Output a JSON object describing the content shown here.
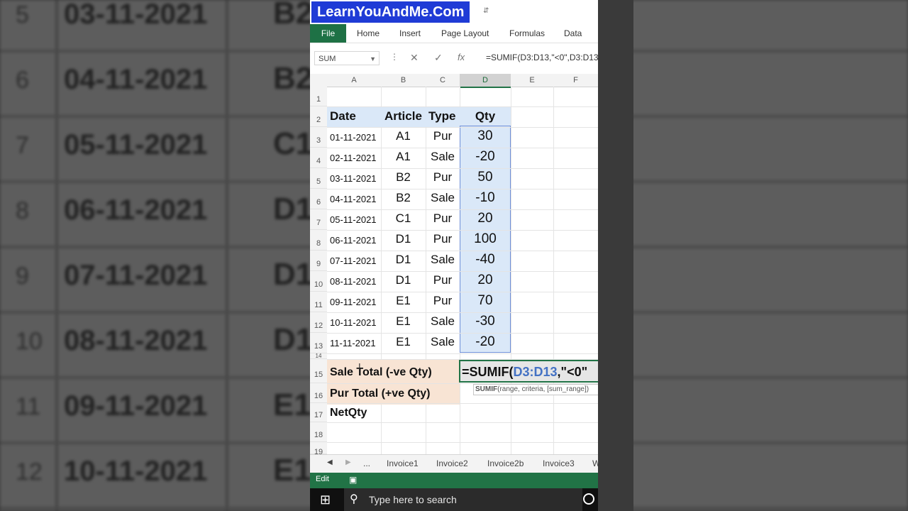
{
  "banner": {
    "title": "LearnYouAndMe.Com"
  },
  "ribbon": {
    "tabs": [
      "File",
      "Home",
      "Insert",
      "Page Layout",
      "Formulas",
      "Data"
    ]
  },
  "formula_bar": {
    "name_box": "SUM",
    "fx": "fx",
    "formula": "=SUMIF(D3:D13,\"<0\",D3:D13"
  },
  "columns": [
    "A",
    "B",
    "C",
    "D",
    "E",
    "F"
  ],
  "selected_column": "D",
  "headers": {
    "date": "Date",
    "article": "Article",
    "type": "Type",
    "qty": "Qty"
  },
  "rows": [
    {
      "row": "3",
      "date": "01-11-2021",
      "article": "A1",
      "type": "Pur",
      "qty": "30"
    },
    {
      "row": "4",
      "date": "02-11-2021",
      "article": "A1",
      "type": "Sale",
      "qty": "-20"
    },
    {
      "row": "5",
      "date": "03-11-2021",
      "article": "B2",
      "type": "Pur",
      "qty": "50"
    },
    {
      "row": "6",
      "date": "04-11-2021",
      "article": "B2",
      "type": "Sale",
      "qty": "-10"
    },
    {
      "row": "7",
      "date": "05-11-2021",
      "article": "C1",
      "type": "Pur",
      "qty": "20"
    },
    {
      "row": "8",
      "date": "06-11-2021",
      "article": "D1",
      "type": "Pur",
      "qty": "100"
    },
    {
      "row": "9",
      "date": "07-11-2021",
      "article": "D1",
      "type": "Sale",
      "qty": "-40"
    },
    {
      "row": "10",
      "date": "08-11-2021",
      "article": "D1",
      "type": "Pur",
      "qty": "20"
    },
    {
      "row": "11",
      "date": "09-11-2021",
      "article": "E1",
      "type": "Pur",
      "qty": "70"
    },
    {
      "row": "12",
      "date": "10-11-2021",
      "article": "E1",
      "type": "Sale",
      "qty": "-30"
    },
    {
      "row": "13",
      "date": "11-11-2021",
      "article": "E1",
      "type": "Sale",
      "qty": "-20"
    }
  ],
  "summary": {
    "sale_label": "Sale Total (-ve Qty)",
    "pur_label": "Pur Total (+ve Qty)",
    "net_label": "NetQty",
    "edit_formula_prefix": "=SUMIF(",
    "edit_formula_range": "D3:D13",
    "edit_formula_suffix": ",\"<0\""
  },
  "tooltip": {
    "fn": "SUMIF",
    "args": "(range, criteria, [sum_range])"
  },
  "sheet_tabs": [
    "Invoice1",
    "Invoice2",
    "Invoice2b",
    "Invoice3",
    "W"
  ],
  "status": {
    "mode": "Edit"
  },
  "taskbar": {
    "search_placeholder": "Type here to search"
  },
  "background": {
    "rows": [
      {
        "num": "5",
        "date": "03-11-2021",
        "article": "B2"
      },
      {
        "num": "6",
        "date": "04-11-2021",
        "article": "B2"
      },
      {
        "num": "7",
        "date": "05-11-2021",
        "article": "C1"
      },
      {
        "num": "8",
        "date": "06-11-2021",
        "article": "D1"
      },
      {
        "num": "9",
        "date": "07-11-2021",
        "article": "D1"
      },
      {
        "num": "10",
        "date": "08-11-2021",
        "article": "D1"
      },
      {
        "num": "11",
        "date": "09-11-2021",
        "article": "E1"
      },
      {
        "num": "12",
        "date": "10-11-2021",
        "article": "E1"
      }
    ]
  },
  "colors": {
    "excel_green": "#217346",
    "banner_blue": "#1f3bd6",
    "range_blue": "#dae8f8",
    "summary_peach": "#f8e4d4"
  }
}
